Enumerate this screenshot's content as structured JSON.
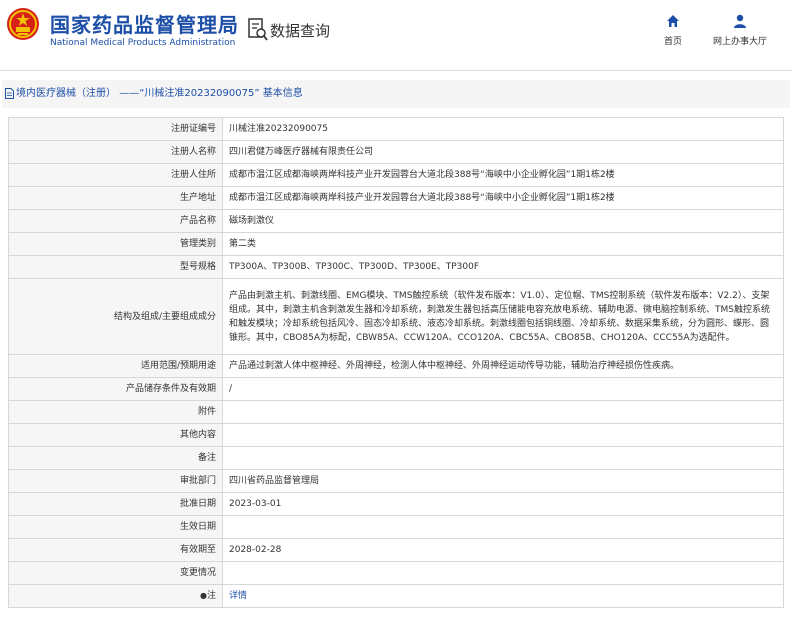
{
  "header": {
    "title_cn": "国家药品监督管理局",
    "title_en": "National Medical Products Administration",
    "query_label": "数据查询",
    "nav": [
      {
        "label": "首页",
        "icon": "home-icon"
      },
      {
        "label": "网上办事大厅",
        "icon": "user-icon"
      }
    ]
  },
  "breadcrumb": {
    "part1": "境内医疗器械（注册）",
    "sep": "——",
    "part2": "“川械注准20232090075”",
    "part3": "基本信息"
  },
  "rows": [
    {
      "label": "注册证编号",
      "value": "川械注准20232090075"
    },
    {
      "label": "注册人名称",
      "value": "四川君健万峰医疗器械有限责任公司"
    },
    {
      "label": "注册人住所",
      "value": "成都市温江区成都海峡两岸科技产业开发园蓉台大道北段388号“海峡中小企业孵化园”1期1栋2楼"
    },
    {
      "label": "生产地址",
      "value": "成都市温江区成都海峡两岸科技产业开发园蓉台大道北段388号“海峡中小企业孵化园”1期1栋2楼"
    },
    {
      "label": "产品名称",
      "value": "磁场刺激仪"
    },
    {
      "label": "管理类别",
      "value": "第二类"
    },
    {
      "label": "型号规格",
      "value": "TP300A、TP300B、TP300C、TP300D、TP300E、TP300F"
    },
    {
      "label": "结构及组成/主要组成成分",
      "value": "产品由刺激主机、刺激线圈、EMG模块、TMS触控系统（软件发布版本：V1.0）、定位帽、TMS控制系统（软件发布版本：V2.2）、支架组成。其中，刺激主机含刺激发生器和冷却系统，刺激发生器包括高压储能电容充放电系统、辅助电源、微电脑控制系统、TMS触控系统和触发模块；冷却系统包括风冷、固态冷却系统、液态冷却系统。刺激线圈包括铜线圈、冷却系统、数据采集系统，分为圆形、蝶形、圆锥形。其中，CBO85A为标配，CBW85A、CCW120A、CCO120A、CBC55A、CBO85B、CHO120A、CCC55A为选配件。"
    },
    {
      "label": "适用范围/预期用途",
      "value": "产品通过刺激人体中枢神经、外周神经，检测人体中枢神经、外周神经运动传导功能，辅助治疗神经损伤性疾病。"
    },
    {
      "label": "产品储存条件及有效期",
      "value": "/"
    },
    {
      "label": "附件",
      "value": ""
    },
    {
      "label": "其他内容",
      "value": ""
    },
    {
      "label": "备注",
      "value": ""
    },
    {
      "label": "审批部门",
      "value": "四川省药品监督管理局"
    },
    {
      "label": "批准日期",
      "value": "2023-03-01"
    },
    {
      "label": "生效日期",
      "value": ""
    },
    {
      "label": "有效期至",
      "value": "2028-02-28"
    },
    {
      "label": "变更情况",
      "value": ""
    },
    {
      "label": "注",
      "value": "详情",
      "pin": "●"
    }
  ],
  "colors": {
    "brand_blue": "#1d4fa8",
    "emblem_red": "#d6201b",
    "emblem_gold": "#f2c200"
  }
}
